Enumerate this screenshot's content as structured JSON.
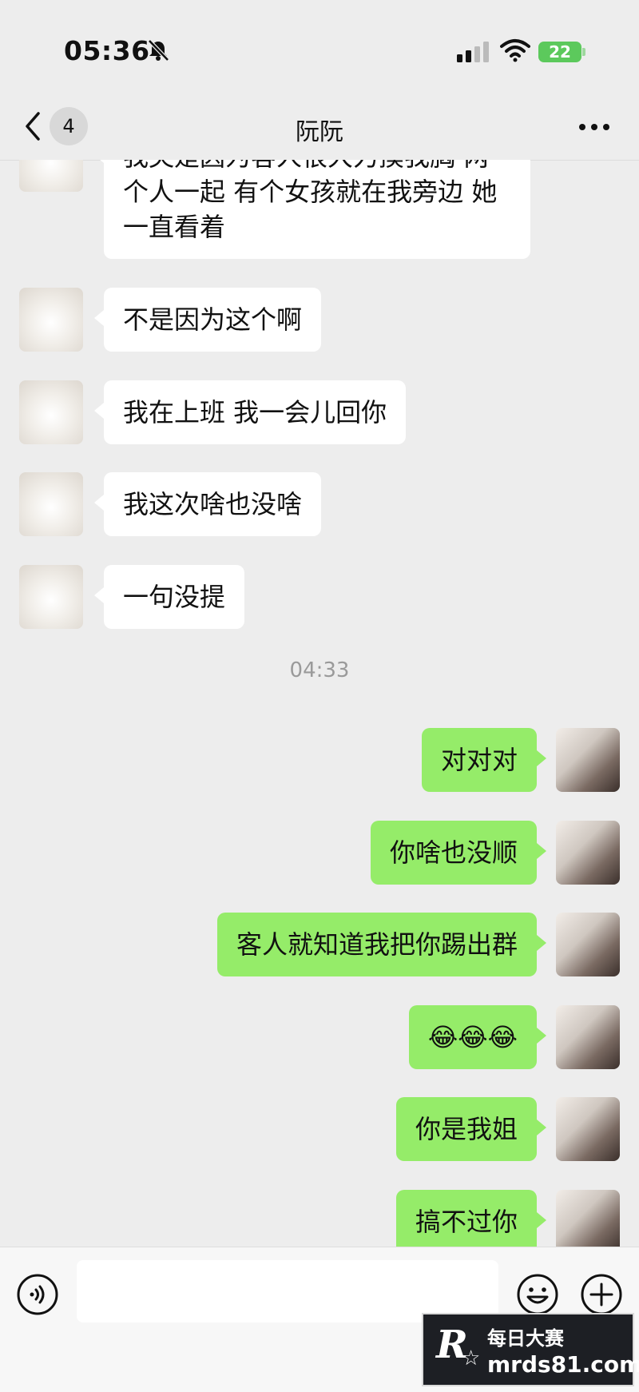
{
  "status_bar": {
    "time": "05:36",
    "battery": "22"
  },
  "nav": {
    "back_count": "4",
    "title": "阮阮"
  },
  "messages": [
    {
      "side": "in",
      "text": "我哭是因为客人很大力摸我胸 两\n个人一起 有个女孩就在我旁边 她\n一直看着"
    },
    {
      "side": "in",
      "text": "不是因为这个啊"
    },
    {
      "side": "in",
      "text": "我在上班 我一会儿回你"
    },
    {
      "side": "in",
      "text": "我这次啥也没啥"
    },
    {
      "side": "in",
      "text": "一句没提"
    },
    {
      "side": "out",
      "text": "对对对"
    },
    {
      "side": "out",
      "text": "你啥也没顺"
    },
    {
      "side": "out",
      "text": "客人就知道我把你踢出群"
    },
    {
      "side": "out",
      "text": "😂😂😂"
    },
    {
      "side": "out",
      "text": "你是我姐"
    },
    {
      "side": "out",
      "text": "搞不过你"
    }
  ],
  "timestamp": "04:33",
  "input": {
    "value": ""
  },
  "watermark": {
    "logo": "R",
    "top_text": "每日大赛",
    "bottom_text": "mrds81.com"
  },
  "colors": {
    "background": "#ededed",
    "incoming_bubble": "#ffffff",
    "outgoing_bubble": "#95ec69",
    "battery": "#5cc95c"
  }
}
